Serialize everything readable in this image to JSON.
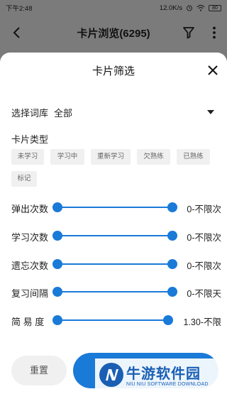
{
  "status_bar": {
    "time": "下午2:48",
    "speed": "12.0K/s",
    "battery": "80"
  },
  "app_bar": {
    "title": "卡片浏览(6295)",
    "back_icon": "back-arrow-icon",
    "filter_icon": "filter-icon",
    "more_icon": "more-vert-icon"
  },
  "sheet": {
    "title": "卡片筛选",
    "close_icon": "close-icon",
    "library": {
      "label": "选择词库",
      "value": "全部"
    },
    "card_type": {
      "label": "卡片类型",
      "chips": [
        "未学习",
        "学习中",
        "重新学习",
        "欠熟练",
        "已熟练",
        "标记"
      ]
    },
    "sliders": [
      {
        "label": "弹出次数",
        "value": "0-不限次",
        "from": 0,
        "to": 1
      },
      {
        "label": "学习次数",
        "value": "0-不限次",
        "from": 0,
        "to": 1
      },
      {
        "label": "遗忘次数",
        "value": "0-不限次",
        "from": 0,
        "to": 1
      },
      {
        "label": "复习间隔",
        "value": "0-不限天",
        "from": 0,
        "to": 1
      },
      {
        "label": "简 易 度",
        "value": "1.30-不限",
        "from": 0,
        "to": 1
      }
    ],
    "reset_label": "重置",
    "accent_color": "#1a7ad8"
  },
  "watermark": {
    "text": "牛游软件园",
    "sub": "NIU NIU SOFTWARE DOWNLOAD"
  }
}
